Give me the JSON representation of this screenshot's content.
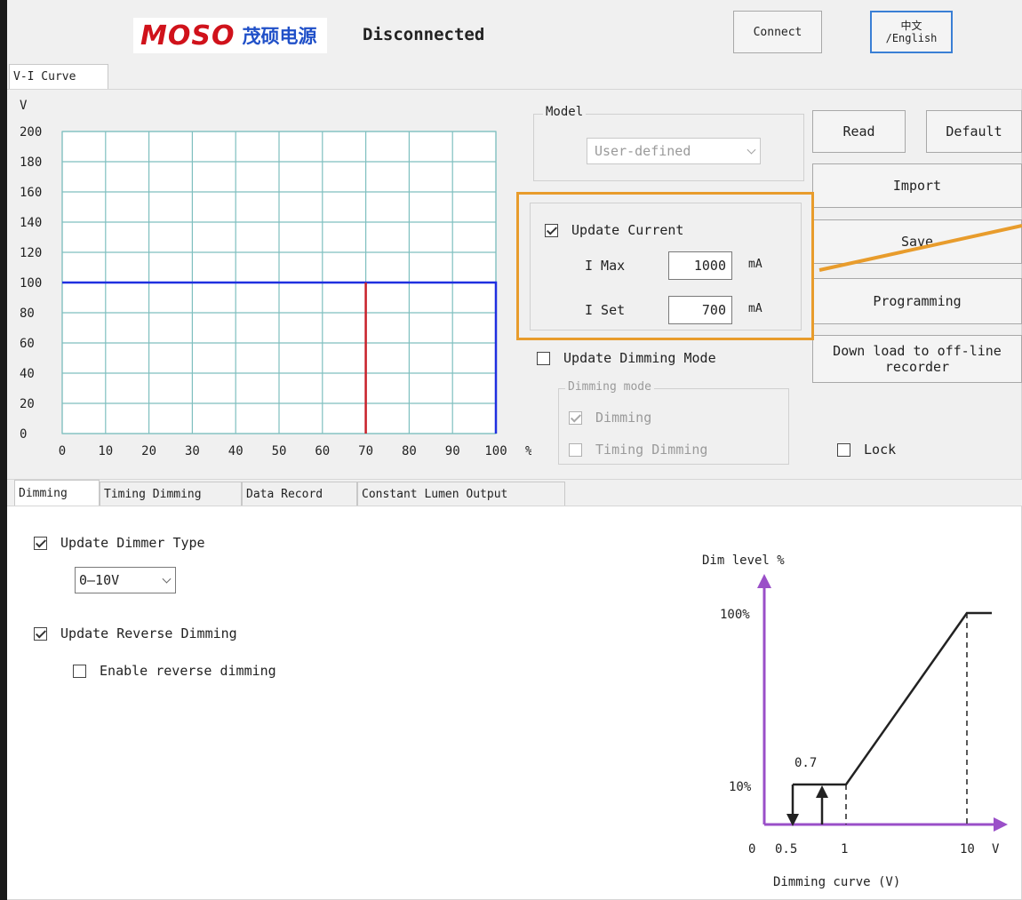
{
  "header": {
    "brand": "MOSO",
    "brand_cn": "茂硕电源",
    "status": "Disconnected",
    "connect_label": "Connect",
    "lang_label_line1": "中文",
    "lang_label_line2": "/English"
  },
  "top_tabs": [
    "V-I Curve"
  ],
  "vi_chart": {
    "y_unit": "V",
    "x_unit": "%",
    "y_ticks": [
      "200",
      "180",
      "160",
      "140",
      "120",
      "100",
      "80",
      "60",
      "40",
      "20",
      "0"
    ],
    "x_ticks": [
      "0",
      "10",
      "20",
      "30",
      "40",
      "50",
      "60",
      "70",
      "80",
      "90",
      "100"
    ]
  },
  "model": {
    "label": "Model",
    "value": "User-defined"
  },
  "buttons": {
    "read": "Read",
    "default": "Default",
    "import": "Import",
    "save": "Save",
    "programming": "Programming",
    "download_line1": "Down load to off-line",
    "download_line2": "recorder"
  },
  "current": {
    "update_label": "Update Current",
    "imax_label": "I Max",
    "imax_value": "1000",
    "imax_unit": "mA",
    "iset_label": "I Set",
    "iset_value": "700",
    "iset_unit": "mA"
  },
  "dimming_mode": {
    "update_label": "Update Dimming Mode",
    "group_label": "Dimming mode",
    "dimming": "Dimming",
    "timing_dimming": "Timing Dimming"
  },
  "lock_label": "Lock",
  "bottom_tabs": [
    "Dimming",
    "Timing Dimming",
    "Data Record",
    "Constant Lumen Output"
  ],
  "dimming_tab": {
    "update_dimmer_type": "Update Dimmer Type",
    "dimmer_type_value": "0—10V",
    "update_reverse": "Update Reverse Dimming",
    "enable_reverse": "Enable reverse dimming"
  },
  "dim_curve": {
    "y_title": "Dim level %",
    "x_title": "Dimming curve (V)",
    "y_100": "100%",
    "y_10": "10%",
    "x_0": "0",
    "x_05": "0.5",
    "x_1": "1",
    "x_10": "10",
    "x_unit": "V",
    "annotation": "0.7"
  },
  "colors": {
    "grid": "#7fbfbf",
    "limit_line": "#1f2fe0",
    "set_line": "#c8202a",
    "highlight": "#e89c2c",
    "axis_purple": "#9a4fc8"
  },
  "chart_data": {
    "type": "line",
    "series": [
      {
        "name": "",
        "x": [
          0,
          100,
          100
        ],
        "y": [
          100,
          100,
          0
        ]
      },
      {
        "name": "",
        "x": [
          70,
          70
        ],
        "y": [
          0,
          100
        ]
      }
    ],
    "xlabel": "%",
    "ylabel": "V",
    "xlim": [
      0,
      100
    ],
    "ylim": [
      0,
      200
    ],
    "grid": true
  }
}
